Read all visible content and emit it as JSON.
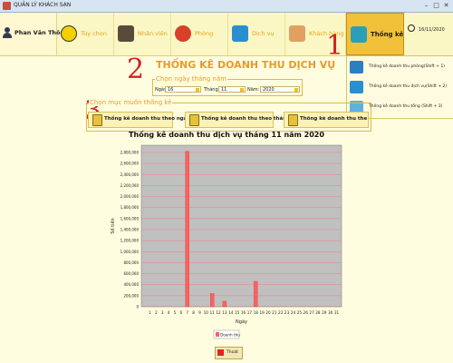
{
  "window": {
    "title": "QUẢN LÝ KHÁCH SẠN"
  },
  "user": {
    "name": "Phan Văn Thông"
  },
  "menu": [
    {
      "label": "Tùy chọn",
      "icon": "list-icon"
    },
    {
      "label": "Nhân viên",
      "icon": "staff-icon"
    },
    {
      "label": "Phòng",
      "icon": "room-icon"
    },
    {
      "label": "Dịch vụ",
      "icon": "service-icon"
    },
    {
      "label": "Khách hàng",
      "icon": "customer-icon"
    },
    {
      "label": "Thống kê",
      "icon": "statistics-icon"
    }
  ],
  "date_corner": "16/11/2020",
  "dropdown": [
    {
      "label": "Thống kê doanh thu phòng(Shift + 1)"
    },
    {
      "label": "Thống kê doanh thu dịch vụ(Shift + 2)"
    },
    {
      "label": "Thống kê doanh thu tổng (Shift + 3)"
    }
  ],
  "annotations": {
    "n1": "1",
    "n2": "2",
    "n3": "3"
  },
  "page_title": "THỐNG KÊ DOANH THU DỊCH VỤ",
  "date_group": {
    "label": "Chọn ngày tháng năm",
    "day_label": "Ngày:",
    "day_value": "16",
    "month_label": "Tháng:",
    "month_value": "11",
    "year_label": "Năm:",
    "year_value": "2020"
  },
  "option_group": {
    "label": "Chọn mục muốn thống kê",
    "by_day": "Thống kê doanh thu theo ngày",
    "by_month": "Thống kê doanh thu theo tháng",
    "by_year": "Thống kê doanh thu theo năm"
  },
  "chart_title": "Thống kê doanh thu dịch vụ tháng 11 năm 2020",
  "chart_data": {
    "type": "bar",
    "categories": [
      "1",
      "2",
      "3",
      "4",
      "5",
      "6",
      "7",
      "8",
      "9",
      "10",
      "11",
      "12",
      "13",
      "14",
      "15",
      "16",
      "17",
      "18",
      "19",
      "20",
      "21",
      "22",
      "23",
      "24",
      "25",
      "26",
      "27",
      "28",
      "29",
      "30",
      "31"
    ],
    "series": [
      {
        "name": "Doanh thu",
        "values": [
          0,
          0,
          0,
          0,
          0,
          0,
          2820000,
          0,
          0,
          0,
          240000,
          0,
          100000,
          0,
          0,
          0,
          0,
          460000,
          0,
          0,
          0,
          0,
          0,
          0,
          0,
          0,
          0,
          0,
          0,
          0,
          0
        ]
      }
    ],
    "xlabel": "Ngày",
    "ylabel": "Số tiền",
    "yticks": [
      "0",
      "200,000",
      "400,000",
      "600,000",
      "800,000",
      "1,000,000",
      "1,200,000",
      "1,400,000",
      "1,600,000",
      "1,800,000",
      "2,000,000",
      "2,200,000",
      "2,400,000",
      "2,600,000",
      "2,800,000"
    ],
    "ylim": [
      0,
      2800000
    ],
    "bar_color": "#ff6060",
    "plot_bg": "#c0c0c0",
    "grid": true,
    "legend": "bottom"
  },
  "exit_button": {
    "label": "Thoát"
  }
}
